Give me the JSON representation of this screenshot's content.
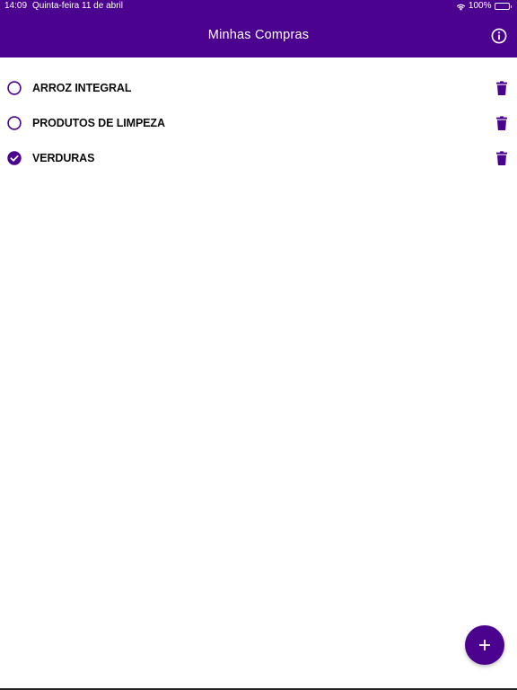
{
  "status_bar": {
    "time": "14:09",
    "date": "Quinta-feira 11 de abril",
    "battery": "100%",
    "wifi_icon": "wifi-icon",
    "battery_icon": "battery-icon"
  },
  "app_bar": {
    "title": "Minhas Compras",
    "info_icon": "info-icon",
    "color": "#4a028f"
  },
  "list": {
    "items": [
      {
        "label": "ARROZ INTEGRAL",
        "checked": false
      },
      {
        "label": "PRODUTOS DE LIMPEZA",
        "checked": false
      },
      {
        "label": "VERDURAS",
        "checked": true
      }
    ],
    "check_icon": "circle-check-icon",
    "delete_icon": "trash-icon"
  },
  "fab": {
    "icon": "plus-icon",
    "color": "#4a028f"
  },
  "colors": {
    "accent": "#4a028f",
    "text": "#0c0c0c",
    "background": "#ffffff"
  }
}
